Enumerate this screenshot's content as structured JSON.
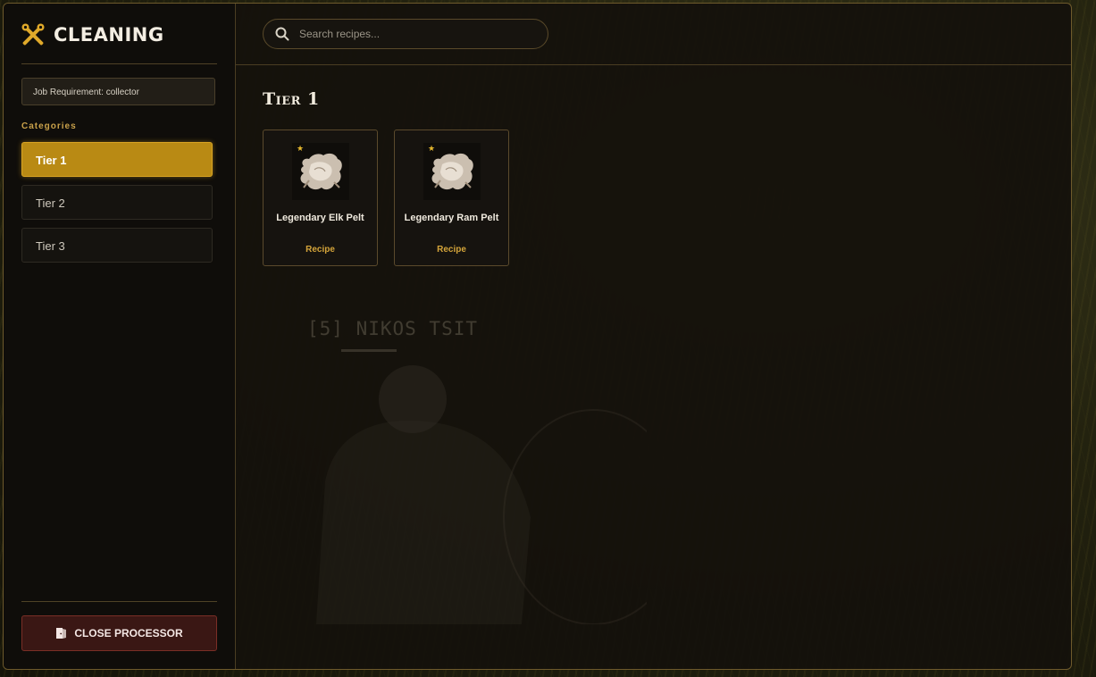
{
  "app": {
    "title": "CLEANING",
    "brand_icon": "crossed-tools-icon",
    "accent_color": "#b98a14",
    "danger_color": "#3a1714"
  },
  "sidebar": {
    "job_requirement": "Job Requirement: collector",
    "categories_heading": "Categories",
    "categories": [
      {
        "label": "Tier 1",
        "active": true
      },
      {
        "label": "Tier 2",
        "active": false
      },
      {
        "label": "Tier 3",
        "active": false
      }
    ],
    "close_button": {
      "label": "CLOSE PROCESSOR",
      "icon": "door-icon"
    }
  },
  "search": {
    "placeholder": "Search recipes...",
    "value": "",
    "icon": "search-icon"
  },
  "main": {
    "section_title": "Tier 1",
    "recipes": [
      {
        "name": "Legendary Elk Pelt",
        "type": "Recipe",
        "icon": "pelt-icon",
        "rarity_icon": "star-icon"
      },
      {
        "name": "Legendary Ram Pelt",
        "type": "Recipe",
        "icon": "pelt-icon",
        "rarity_icon": "star-icon"
      }
    ]
  },
  "background": {
    "player_name": "[5] NIKOS TSIT"
  }
}
